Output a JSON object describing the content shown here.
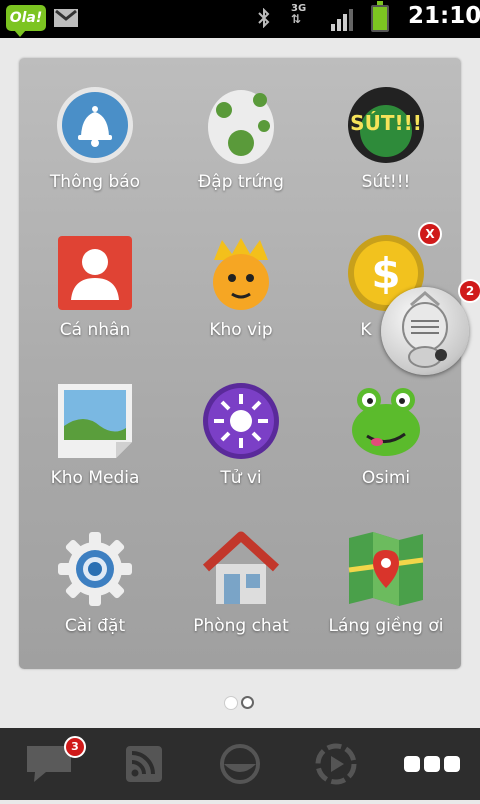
{
  "status_bar": {
    "app_badge": "Ola!",
    "network": "3G",
    "time": "21:10",
    "icons": [
      "gmail-icon",
      "bluetooth-icon",
      "network-3g-icon",
      "signal-icon",
      "battery-icon"
    ]
  },
  "apps": [
    {
      "label": "Thông báo",
      "icon": "bell-icon"
    },
    {
      "label": "Đập trứng",
      "icon": "egg-icon"
    },
    {
      "label": "Sút!!!",
      "icon": "soccer-icon"
    },
    {
      "label": "Cá nhân",
      "icon": "person-icon"
    },
    {
      "label": "Kho vip",
      "icon": "king-icon"
    },
    {
      "label": "K",
      "icon": "coin-icon"
    },
    {
      "label": "Kho Media",
      "icon": "image-icon"
    },
    {
      "label": "Tử vi",
      "icon": "sun-icon"
    },
    {
      "label": "Osimi",
      "icon": "frog-icon"
    },
    {
      "label": "Cài đặt",
      "icon": "gear-icon"
    },
    {
      "label": "Phòng chat",
      "icon": "house-icon"
    },
    {
      "label": "Láng giềng ơi",
      "icon": "map-icon"
    }
  ],
  "remove_badge": "X",
  "floater_badge": "2",
  "page_indicator": {
    "pages": 2,
    "current": 1
  },
  "nav": {
    "messages_badge": "3",
    "items": [
      "chat-icon",
      "rss-icon",
      "face-icon",
      "music-icon",
      "more-icon"
    ]
  },
  "colors": {
    "accent_green": "#7cc421",
    "badge_red": "#d01a1a",
    "navbar": "#2d2d2d"
  }
}
